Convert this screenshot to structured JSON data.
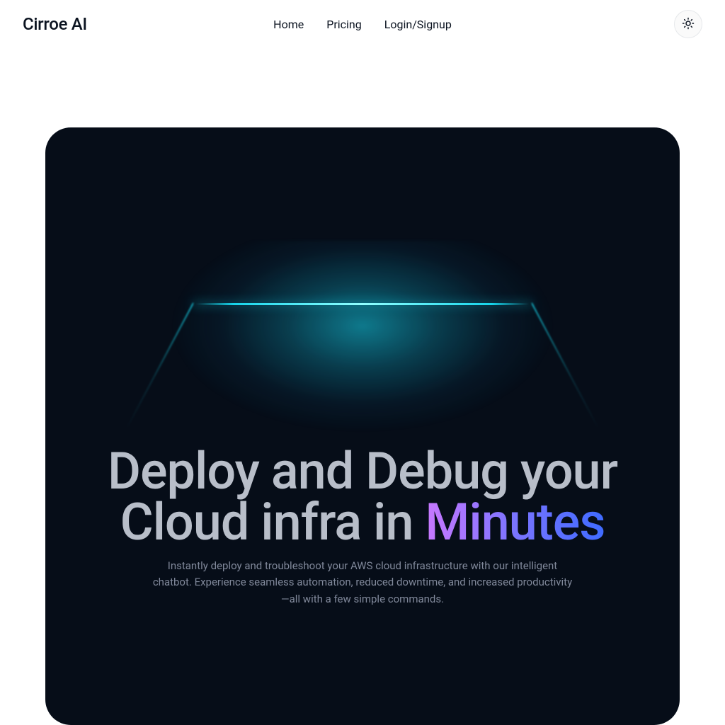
{
  "brand": "Cirroe AI",
  "nav": {
    "home": "Home",
    "pricing": "Pricing",
    "login": "Login/Signup"
  },
  "hero": {
    "headline_prefix": "Deploy and Debug your Cloud infra in ",
    "headline_gradient": "Minutes",
    "subtitle": "Instantly deploy and troubleshoot your AWS cloud infrastructure with our intelligent chatbot. Experience seamless automation, reduced downtime, and increased productivity—all with a few simple commands."
  },
  "colors": {
    "accent_glow": "#18e8ff",
    "hero_bg": "#060d18",
    "gradient_start": "#c978ff",
    "gradient_end": "#3f6bff"
  }
}
